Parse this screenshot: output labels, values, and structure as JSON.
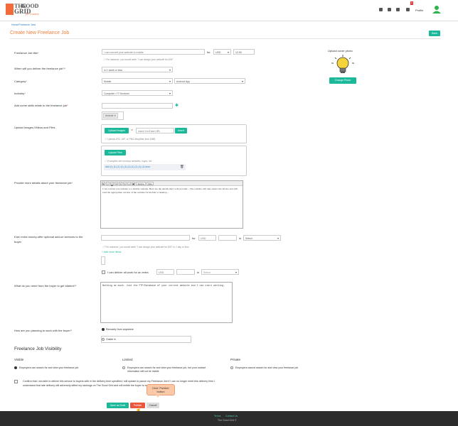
{
  "header": {
    "logo": {
      "line1": "THE",
      "line2": "GOOD",
      "line3": "GRID",
      "tagline": "for Country"
    },
    "breadcrumb": "Home/Freelance Jobs",
    "badge_count": "3",
    "profile_label": "Profile"
  },
  "page": {
    "title": "Create New Freelance Job",
    "back_label": "Back"
  },
  "form": {
    "title_label": "Freelance Job title",
    "title_placeholder": "I can convert your website to mobile",
    "for_label": "for",
    "currency": "USD",
    "price_value": "12.00",
    "title_hint": "For instance, you would write \"I can design your website for $30\"",
    "delivery_label": "When will you deliver the freelance job?",
    "delivery_value": "in 1 week or less",
    "category_label": "Category",
    "category_value": "Mobile",
    "subcategory_value": "Android App",
    "industry_label": "Industry",
    "industry_value": "Computer / IT Services",
    "skills_label": "Add some skills relate to the freelance job",
    "skill_chip": "Android",
    "upload_label": "Upload Images,Videos and Files",
    "upload_images_btn": "Upload Images",
    "or_label": "or",
    "youtube_placeholder": "Insert YouTube URL",
    "insert_btn": "Insert",
    "upload_hint": "Upload JPG, GIF, or PNG files(Max limit 1MB)",
    "upload_files_btn": "Upload Files",
    "files_hint": "Examples are mockup websites, logos, etc",
    "file_name": "Add (1) (1) (1) (1) (1) (1) (1) (1) (1) (1).docx",
    "cover_label": "Upload cover photo",
    "change_photo_btn": "Change Photo",
    "details_label": "Provide more details about your freelance job",
    "editor_source": "Source",
    "editor_size": "Size",
    "details_text": "I can convert you website to a mobile website. Here are the details that I will provide: - The website will auto-detect the device and will load the appropriate version of the website for mobile or desktop -",
    "addon_label_1": "Earn extra money-offer optional add-on services to the",
    "addon_label_2": "buyer",
    "addon_for": "for",
    "addon_currency": "USD",
    "addon_in": "in",
    "addon_select": "Select",
    "addon_hint": "For instance, you would write \"I can design your website for $30\" in 1 day or less",
    "add_more": "+ Add more items",
    "extra_label": "I can deliver all work for an extra",
    "extra_currency": "USD",
    "extra_in": "in",
    "extra_select": "Select",
    "buyer_needs_label": "What do you need from the buyer to get started?",
    "buyer_needs_text": "Nothing as much. Just the FTP/Database of your current website and I can start working.",
    "work_label": "How are you planning to work with the buyer?",
    "work_remote": "Remotely from anywhere",
    "work_onsite": "Onsite in"
  },
  "visibility": {
    "title": "Freelance Job Visibility",
    "visible_head": "Visible",
    "visible_desc": "Employers can search for and view your freelance job",
    "limited_head": "Limited",
    "limited_desc_1": "Employers can search for and view your freelance job, but your contact",
    "limited_desc_2": "information will not be visible",
    "private_head": "Private",
    "private_desc": "Employers cannot search for and view your freelance job"
  },
  "confirm": {
    "line1": "Confirm that I am able to deliver this service to buyers with in the delivery time specified.I will update to pause my Freelance Job if I can no longer meet this delivery time.I",
    "line2": "understand that late delivery will adversely affect my rankings on The Good Grid and will entitle the buyer to refund.see",
    "tcs": "T&Cs"
  },
  "actions": {
    "draft": "Save as Draft",
    "publish": "Publish",
    "cancel": "Cancel"
  },
  "tooltip": {
    "line1": "Click 'Publish'",
    "line2": "button"
  },
  "footer": {
    "terms": "Terms",
    "contact": "Contact Us",
    "copyright": "The Good Grid ©"
  },
  "colors": {
    "accent": "#f0813f",
    "green": "#1bb99a",
    "publish": "#e9573f"
  }
}
